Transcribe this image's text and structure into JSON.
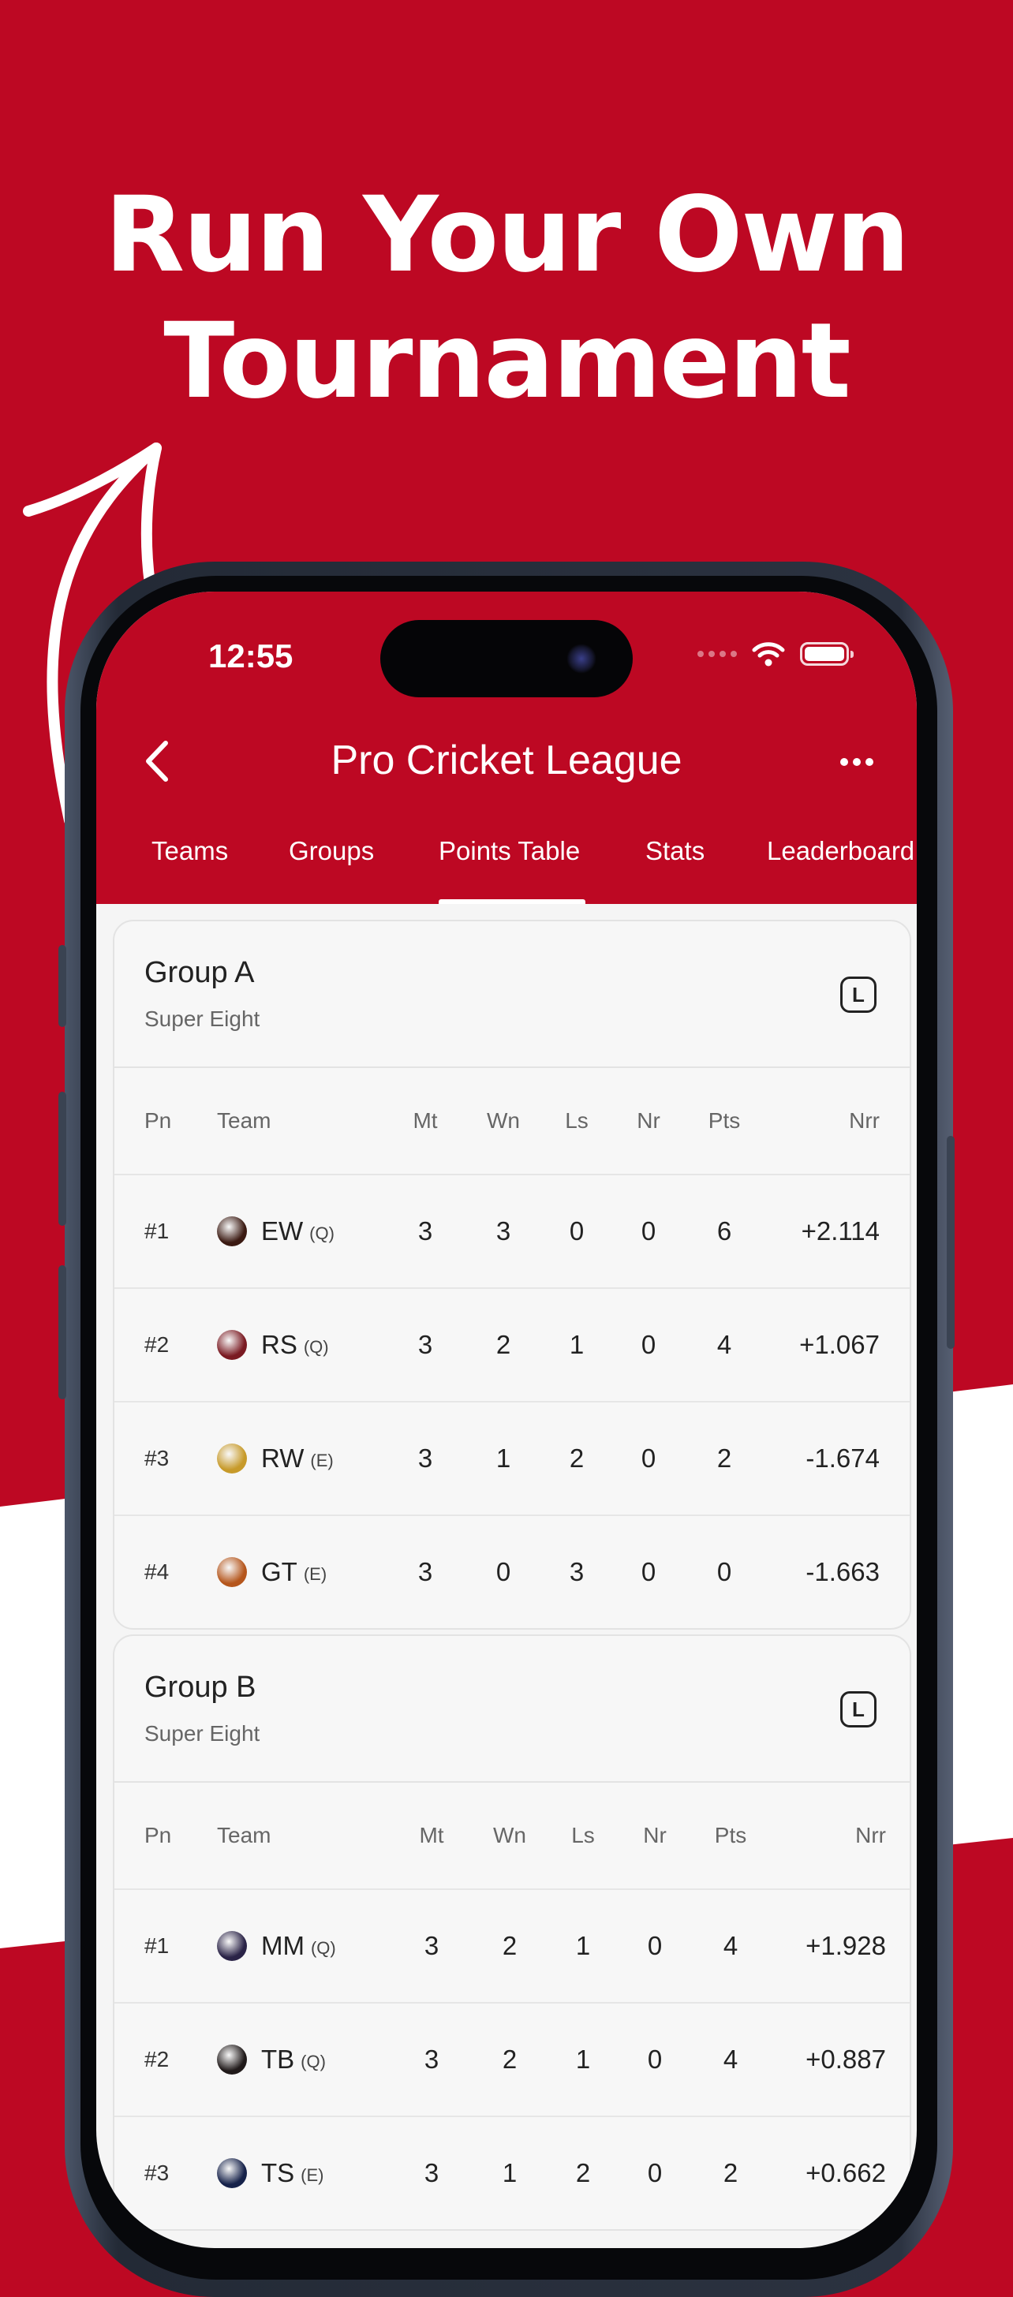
{
  "promo": {
    "headline_line1": "Run Your Own",
    "headline_line2": "Tournament"
  },
  "status_bar": {
    "time": "12:55"
  },
  "header": {
    "title": "Pro Cricket League",
    "back_icon": "chevron-left-icon",
    "more_icon": "ellipsis-icon"
  },
  "tabs": [
    {
      "label": "Teams",
      "active": false
    },
    {
      "label": "Groups",
      "active": false
    },
    {
      "label": "Points Table",
      "active": true
    },
    {
      "label": "Stats",
      "active": false
    },
    {
      "label": "Leaderboard",
      "active": false
    }
  ],
  "columns": {
    "pn": "Pn",
    "team": "Team",
    "mt": "Mt",
    "wn": "Wn",
    "ls": "Ls",
    "nr": "Nr",
    "pts": "Pts",
    "nrr": "Nrr"
  },
  "groups": [
    {
      "name": "Group A",
      "stage": "Super Eight",
      "badge": "L",
      "rows": [
        {
          "pn": "#1",
          "team": "EW",
          "tag": "(Q)",
          "logo_color": "#3b1a12",
          "mt": "3",
          "wn": "3",
          "ls": "0",
          "nr": "0",
          "pts": "6",
          "nrr": "+2.114"
        },
        {
          "pn": "#2",
          "team": "RS",
          "tag": "(Q)",
          "logo_color": "#7a1a22",
          "mt": "3",
          "wn": "2",
          "ls": "1",
          "nr": "0",
          "pts": "4",
          "nrr": "+1.067"
        },
        {
          "pn": "#3",
          "team": "RW",
          "tag": "(E)",
          "logo_color": "#c79a2a",
          "mt": "3",
          "wn": "1",
          "ls": "2",
          "nr": "0",
          "pts": "2",
          "nrr": "-1.674"
        },
        {
          "pn": "#4",
          "team": "GT",
          "tag": "(E)",
          "logo_color": "#b5561c",
          "mt": "3",
          "wn": "0",
          "ls": "3",
          "nr": "0",
          "pts": "0",
          "nrr": "-1.663"
        }
      ]
    },
    {
      "name": "Group B",
      "stage": "Super Eight",
      "badge": "L",
      "rows": [
        {
          "pn": "#1",
          "team": "MM",
          "tag": "(Q)",
          "logo_color": "#2a2347",
          "mt": "3",
          "wn": "2",
          "ls": "1",
          "nr": "0",
          "pts": "4",
          "nrr": "+1.928"
        },
        {
          "pn": "#2",
          "team": "TB",
          "tag": "(Q)",
          "logo_color": "#201a1a",
          "mt": "3",
          "wn": "2",
          "ls": "1",
          "nr": "0",
          "pts": "4",
          "nrr": "+0.887"
        },
        {
          "pn": "#3",
          "team": "TS",
          "tag": "(E)",
          "logo_color": "#16224a",
          "mt": "3",
          "wn": "1",
          "ls": "2",
          "nr": "0",
          "pts": "2",
          "nrr": "+0.662"
        }
      ]
    }
  ],
  "colors": {
    "brand": "#bd0823",
    "white": "#ffffff"
  }
}
